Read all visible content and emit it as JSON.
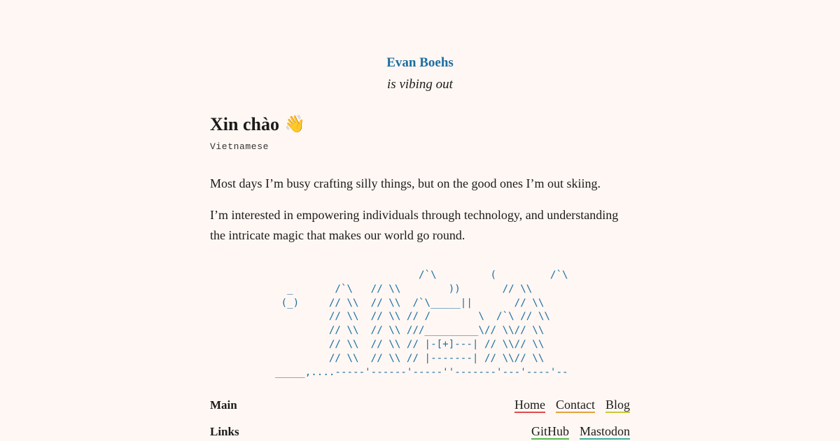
{
  "header": {
    "site_title": "Evan Boehs",
    "tagline": "is vibing out"
  },
  "intro": {
    "greeting": "Xin chào",
    "wave_emoji": "👋",
    "language": "Vietnamese",
    "paragraph_1": "Most days I’m busy crafting silly things, but on the good ones I’m out skiing.",
    "paragraph_2": "I’m interested in empowering individuals through technology, and understanding the intricate magic that makes our world go round."
  },
  "ascii_art": "                        /`\\         (         /`\\\n  _       /`\\   // \\\\        ))       // \\\\\n (_)     // \\\\  // \\\\  /`\\_____||       // \\\\\n         // \\\\  // \\\\ // /        \\  /`\\ // \\\\\n         // \\\\  // \\\\ ///_________\\// \\\\// \\\\\n         // \\\\  // \\\\ // |-[+]---| // \\\\// \\\\\n         // \\\\  // \\\\ // |-------| // \\\\// \\\\\n_____,....-----'------'-----''-------'---'----'--",
  "nav": {
    "main": {
      "label": "Main",
      "links": [
        "Home",
        "Contact",
        "Blog"
      ]
    },
    "links": {
      "label": "Links",
      "links": [
        "GitHub",
        "Mastodon"
      ]
    }
  },
  "colors": {
    "background": "#fff7f3",
    "accent": "#1b6fa3",
    "underline_home": "#e14b4b",
    "underline_contact": "#e2a23c",
    "underline_blog": "#c9c93a",
    "underline_github": "#57b84d",
    "underline_mastodon": "#3fae9c"
  }
}
